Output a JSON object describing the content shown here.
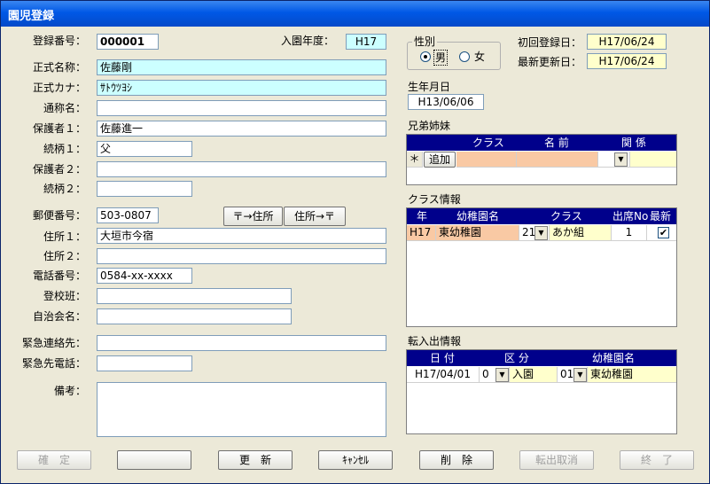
{
  "window": {
    "title": "園児登録"
  },
  "form": {
    "reg_no_label": "登録番号：",
    "reg_no": "000001",
    "entry_year_label": "入園年度：",
    "entry_year": "H17",
    "name_label": "正式名称：",
    "name": "佐藤剛",
    "kana_label": "正式カナ：",
    "kana": "ｻﾄｳﾂﾖｼ",
    "nickname_label": "通称名：",
    "nickname": "",
    "guardian1_label": "保護者１：",
    "guardian1": "佐藤進一",
    "relation1_label": "続柄１：",
    "relation1": "父",
    "guardian2_label": "保護者２：",
    "guardian2": "",
    "relation2_label": "続柄２：",
    "relation2": "",
    "postal_label": "郵便番号：",
    "postal": "503-0807",
    "postal_to_address": "〒→住所",
    "address_to_postal": "住所→〒",
    "address1_label": "住所１：",
    "address1": "大垣市今宿",
    "address2_label": "住所２：",
    "address2": "",
    "phone_label": "電話番号：",
    "phone": "0584-xx-xxxx",
    "school_group_label": "登校班：",
    "school_group": "",
    "association_label": "自治会名：",
    "association": "",
    "emergency_contact_label": "緊急連絡先：",
    "emergency_contact": "",
    "emergency_phone_label": "緊急先電話：",
    "emergency_phone": "",
    "notes_label": "備考：",
    "notes": ""
  },
  "gender": {
    "legend": "性別",
    "male": "男",
    "female": "女",
    "selected": "male"
  },
  "dates": {
    "first_reg_label": "初回登録日：",
    "first_reg": "H17/06/24",
    "last_update_label": "最新更新日：",
    "last_update": "H17/06/24"
  },
  "birth": {
    "label": "生年月日",
    "value": "H13/06/06"
  },
  "siblings": {
    "label": "兄弟姉妹",
    "headers": [
      "クラス",
      "名 前",
      "関 係"
    ],
    "row_marker": "＊",
    "add_button": "追加"
  },
  "class_info": {
    "label": "クラス情報",
    "headers": [
      "年",
      "幼稚園名",
      "クラス",
      "出席No",
      "最新"
    ],
    "rows": [
      {
        "year": "H17",
        "kindergarten": "東幼稚園",
        "class_no": "21",
        "class_name": "あか組",
        "attendance": "1",
        "latest": "✔"
      }
    ]
  },
  "transfer": {
    "label": "転入出情報",
    "headers": [
      "日 付",
      "区 分",
      "幼稚園名"
    ],
    "rows": [
      {
        "date": "H17/04/01",
        "type_no": "0",
        "type": "入園",
        "kg_no": "01",
        "kindergarten": "東幼稚園"
      }
    ]
  },
  "buttons": {
    "confirm": "確　定",
    "blank": "",
    "update": "更　新",
    "cancel": "ｷｬﾝｾﾙ",
    "delete": "削　除",
    "cancel_transfer": "転出取消",
    "exit": "終　了"
  }
}
